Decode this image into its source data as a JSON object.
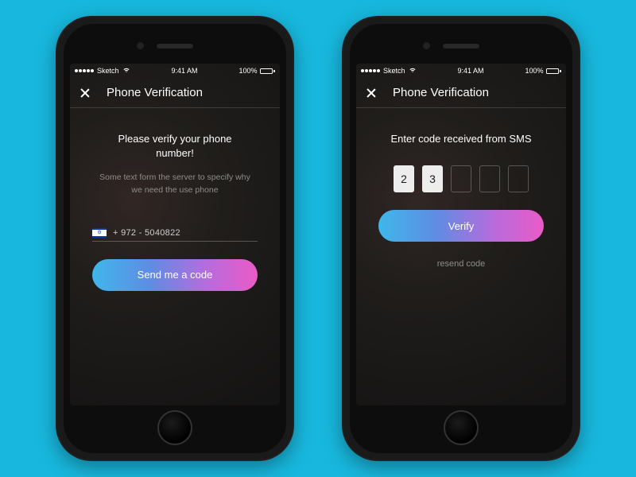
{
  "statusbar": {
    "carrier": "Sketch",
    "time": "9:41 AM",
    "battery": "100%"
  },
  "nav": {
    "title": "Phone Verification"
  },
  "screen1": {
    "heading": "Please verify your phone number!",
    "subtext": "Some text form the server to specify why we need the use phone",
    "phone_number": "+ 972 - 5040822",
    "button_label": "Send me a code"
  },
  "screen2": {
    "heading": "Enter code received from SMS",
    "code_digits": [
      "2",
      "3",
      "",
      "",
      ""
    ],
    "button_label": "Verify",
    "resend_label": "resend code"
  }
}
